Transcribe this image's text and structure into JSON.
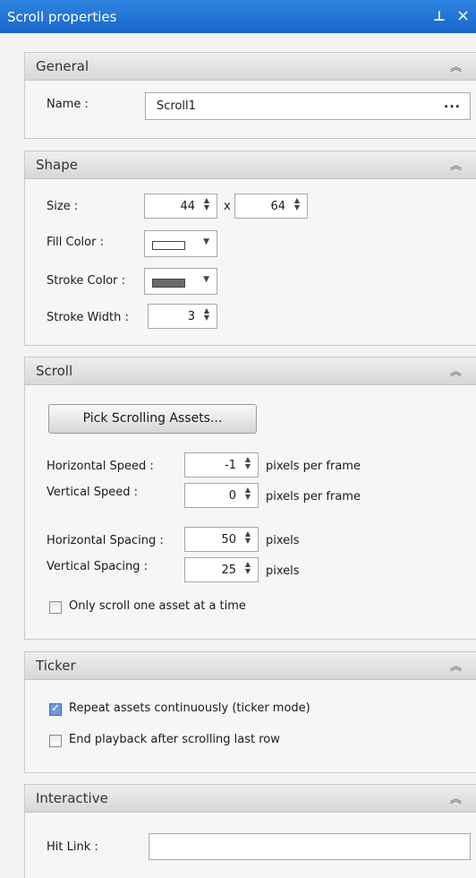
{
  "window": {
    "title": "Scroll properties",
    "pin_icon": "pin-icon",
    "close_glyph": "×"
  },
  "general": {
    "title": "General",
    "name_label": "Name :",
    "name_value": "Scroll1",
    "browse_label": "..."
  },
  "shape": {
    "title": "Shape",
    "size_label": "Size :",
    "width_value": "44",
    "x_sep": "x",
    "height_value": "64",
    "fill_label": "Fill Color :",
    "fill_color": "#ffffff",
    "stroke_label": "Stroke Color :",
    "stroke_color": "#6b6b6b",
    "stroke_width_label": "Stroke Width :",
    "stroke_width_value": "3"
  },
  "scroll": {
    "title": "Scroll",
    "pick_button": "Pick Scrolling Assets...",
    "h_speed_label": "Horizontal Speed :",
    "h_speed_value": "-1",
    "h_speed_unit": "pixels per frame",
    "v_speed_label": "Vertical Speed :",
    "v_speed_value": "0",
    "v_speed_unit": "pixels per frame",
    "h_spacing_label": "Horizontal Spacing :",
    "h_spacing_value": "50",
    "h_spacing_unit": "pixels",
    "v_spacing_label": "Vertical Spacing :",
    "v_spacing_value": "25",
    "v_spacing_unit": "pixels",
    "one_asset_label": "Only scroll one asset at a time",
    "one_asset_checked": false
  },
  "ticker": {
    "title": "Ticker",
    "repeat_label": "Repeat assets continuously (ticker mode)",
    "repeat_checked": true,
    "end_label": "End playback after scrolling last row",
    "end_checked": false
  },
  "interactive": {
    "title": "Interactive",
    "hit_link_label": "Hit Link :",
    "hit_link_value": ""
  },
  "chevron": "≈"
}
